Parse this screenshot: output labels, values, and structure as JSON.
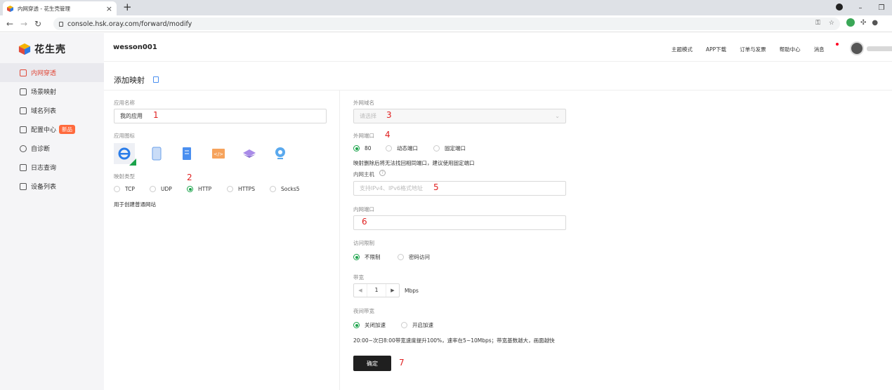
{
  "browser": {
    "tab_title": "内网穿透 - 花生壳管理",
    "url": "console.hsk.oray.com/forward/modify"
  },
  "sidebar": {
    "logo_text": "花生壳",
    "items": [
      {
        "label": "内网穿透",
        "active": true
      },
      {
        "label": "场景映射"
      },
      {
        "label": "域名列表"
      },
      {
        "label": "配置中心",
        "badge": "新品"
      },
      {
        "label": "自诊断"
      },
      {
        "label": "日志查询"
      },
      {
        "label": "设备列表"
      }
    ]
  },
  "header": {
    "username": "wesson001",
    "nav": [
      "主题模式",
      "APP下载",
      "订单与发票",
      "帮助中心",
      "消息"
    ]
  },
  "page": {
    "title": "添加映射"
  },
  "form": {
    "app_name": {
      "label": "应用名称",
      "value": "我的应用",
      "step": "1"
    },
    "app_icon": {
      "label": "应用图标"
    },
    "mapping_type": {
      "label": "映射类型",
      "step": "2",
      "options": [
        "TCP",
        "UDP",
        "HTTP",
        "HTTPS",
        "Socks5"
      ],
      "selected": "HTTP",
      "hint": "用于创建普通网站"
    },
    "ext_domain": {
      "label": "外网域名",
      "placeholder": "请选择",
      "step": "3"
    },
    "ext_port": {
      "label": "外网端口",
      "step": "4",
      "options": [
        "80",
        "动态端口",
        "固定端口"
      ],
      "selected": "80",
      "hint": "映射删除后将无法找回相同端口，建议使用固定端口"
    },
    "int_host": {
      "label": "内网主机",
      "placeholder": "支持IPv4、IPv6格式地址",
      "step": "5"
    },
    "int_port": {
      "label": "内网端口",
      "value": "",
      "step": "6"
    },
    "access_limit": {
      "label": "访问限制",
      "options": [
        "不限制",
        "密码访问"
      ],
      "selected": "不限制"
    },
    "bandwidth": {
      "label": "带宽",
      "value": "1",
      "unit": "Mbps"
    },
    "night_bw": {
      "label": "夜间带宽",
      "options": [
        "关闭加速",
        "开启加速"
      ],
      "selected": "关闭加速",
      "hint": "20:00~次日8:00带宽速度提升100%，速率在5~10Mbps；带宽基数越大，画面越快"
    },
    "confirm": {
      "label": "确定",
      "step": "7"
    }
  },
  "colors": {
    "accent_red": "#e04a3b",
    "radio_green": "#1aa34a",
    "step_red": "#e02020"
  }
}
